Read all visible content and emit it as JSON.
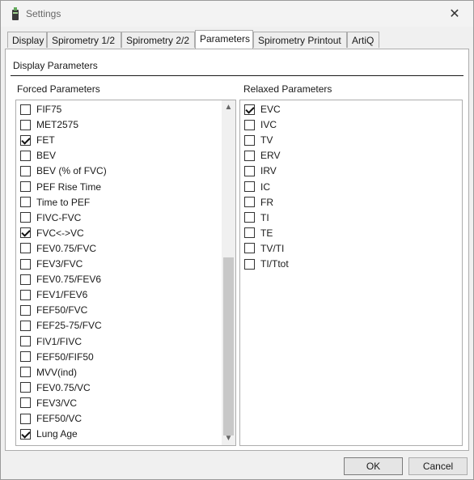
{
  "window": {
    "title": "Settings"
  },
  "tabs": [
    {
      "label": "Display"
    },
    {
      "label": "Spirometry 1/2"
    },
    {
      "label": "Spirometry 2/2"
    },
    {
      "label": "Parameters"
    },
    {
      "label": "Spirometry Printout"
    },
    {
      "label": "ArtiQ"
    }
  ],
  "active_tab": "Parameters",
  "section_title": "Display Parameters",
  "forced": {
    "label": "Forced Parameters",
    "items": [
      {
        "label": "FIF75",
        "checked": false
      },
      {
        "label": "MET2575",
        "checked": false
      },
      {
        "label": "FET",
        "checked": true
      },
      {
        "label": "BEV",
        "checked": false
      },
      {
        "label": "BEV (% of FVC)",
        "checked": false
      },
      {
        "label": "PEF Rise Time",
        "checked": false
      },
      {
        "label": "Time to PEF",
        "checked": false
      },
      {
        "label": "FIVC-FVC",
        "checked": false
      },
      {
        "label": "FVC<->VC",
        "checked": true
      },
      {
        "label": "FEV0.75/FVC",
        "checked": false
      },
      {
        "label": "FEV3/FVC",
        "checked": false
      },
      {
        "label": "FEV0.75/FEV6",
        "checked": false
      },
      {
        "label": "FEV1/FEV6",
        "checked": false
      },
      {
        "label": "FEF50/FVC",
        "checked": false
      },
      {
        "label": "FEF25-75/FVC",
        "checked": false
      },
      {
        "label": "FIV1/FIVC",
        "checked": false
      },
      {
        "label": "FEF50/FIF50",
        "checked": false
      },
      {
        "label": "MVV(ind)",
        "checked": false
      },
      {
        "label": "FEV0.75/VC",
        "checked": false
      },
      {
        "label": "FEV3/VC",
        "checked": false
      },
      {
        "label": "FEF50/VC",
        "checked": false
      },
      {
        "label": "Lung Age",
        "checked": true
      }
    ]
  },
  "relaxed": {
    "label": "Relaxed Parameters",
    "items": [
      {
        "label": "EVC",
        "checked": true
      },
      {
        "label": "IVC",
        "checked": false
      },
      {
        "label": "TV",
        "checked": false
      },
      {
        "label": "ERV",
        "checked": false
      },
      {
        "label": "IRV",
        "checked": false
      },
      {
        "label": "IC",
        "checked": false
      },
      {
        "label": "FR",
        "checked": false
      },
      {
        "label": "TI",
        "checked": false
      },
      {
        "label": "TE",
        "checked": false
      },
      {
        "label": "TV/TI",
        "checked": false
      },
      {
        "label": "TI/Ttot",
        "checked": false
      }
    ]
  },
  "buttons": {
    "ok": "OK",
    "cancel": "Cancel"
  },
  "icons": {
    "app": "settings-app-icon",
    "close": "close-icon",
    "scroll_up": "chevron-up-icon",
    "scroll_down": "chevron-down-icon"
  },
  "colors": {
    "window_bg": "#f0f0f0",
    "panel_bg": "#ffffff",
    "border": "#adadad",
    "thumb": "#c8c8c8"
  }
}
